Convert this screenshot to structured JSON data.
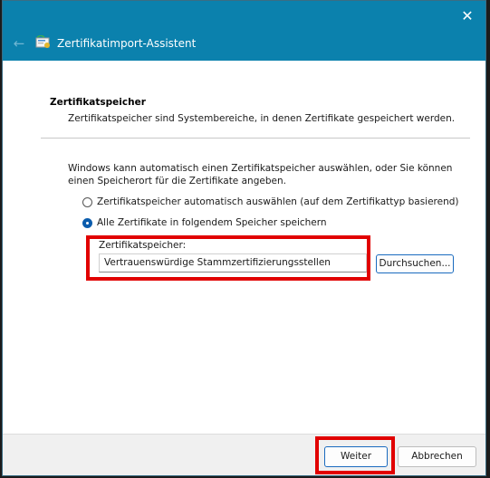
{
  "window": {
    "title": "Zertifikatimport-Assistent",
    "close_symbol": "✕",
    "back_symbol": "←"
  },
  "section": {
    "title": "Zertifikatspeicher",
    "description": "Zertifikatspeicher sind Systembereiche, in denen Zertifikate gespeichert werden."
  },
  "intro": "Windows kann automatisch einen Zertifikatspeicher auswählen, oder Sie können einen Speicherort für die Zertifikate angeben.",
  "options": [
    {
      "label": "Zertifikatspeicher automatisch auswählen (auf dem Zertifikattyp basierend)",
      "selected": false
    },
    {
      "label": "Alle Zertifikate in folgendem Speicher speichern",
      "selected": true
    }
  ],
  "store": {
    "label": "Zertifikatspeicher:",
    "value": "Vertrauenswürdige Stammzertifizierungsstellen",
    "browse_label": "Durchsuchen..."
  },
  "footer": {
    "next_label": "Weiter",
    "cancel_label": "Abbrechen"
  },
  "colors": {
    "titlebar": "#0b81ad",
    "highlight": "#e10000",
    "accent": "#0b5cad"
  }
}
